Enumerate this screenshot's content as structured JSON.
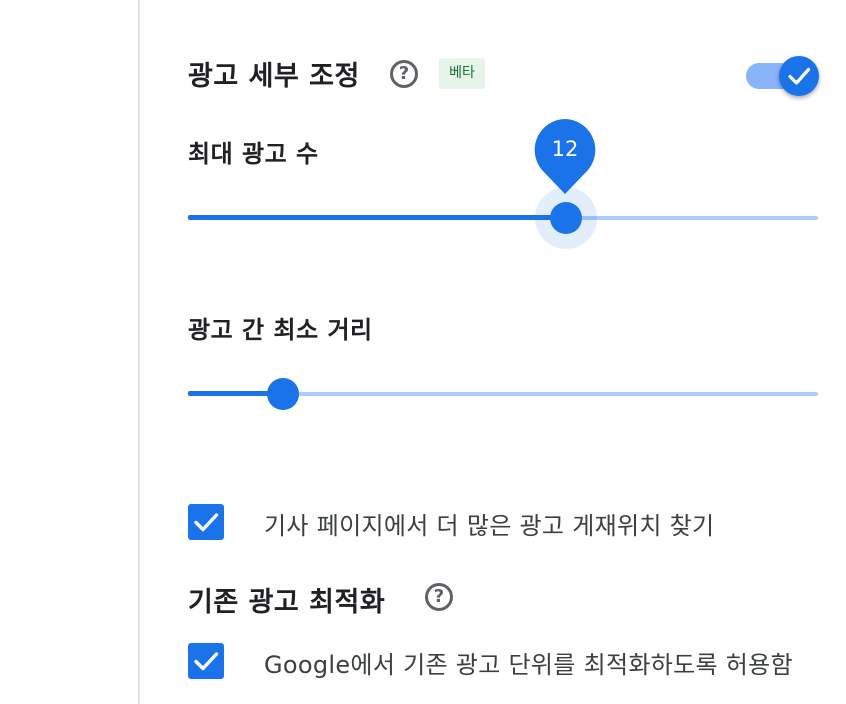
{
  "ad_refinement": {
    "title": "광고 세부 조정",
    "help_icon": "help-circle-icon",
    "badge": "베타",
    "toggle_on": true,
    "toggle_icon": "check-icon"
  },
  "max_ads": {
    "label": "최대 광고 수",
    "value_label": "12",
    "level_fraction": 0.6
  },
  "min_distance": {
    "label": "광고 간 최소 거리",
    "level_fraction": 0.15
  },
  "article_pages": {
    "checked": true,
    "label": "기사 페이지에서 더 많은 광고 게재위치 찾기"
  },
  "existing_ads": {
    "title": "기존 광고 최적화",
    "help_icon": "help-circle-icon",
    "checked": true,
    "label": "Google에서 기존 광고 단위를 최적화하도록 허용함"
  },
  "colors": {
    "accent": "#1a73e8",
    "track_inactive": "#aecbfa",
    "toggle_track": "#8ab4f8",
    "badge_bg": "#e6f4ea",
    "badge_text": "#137333"
  }
}
